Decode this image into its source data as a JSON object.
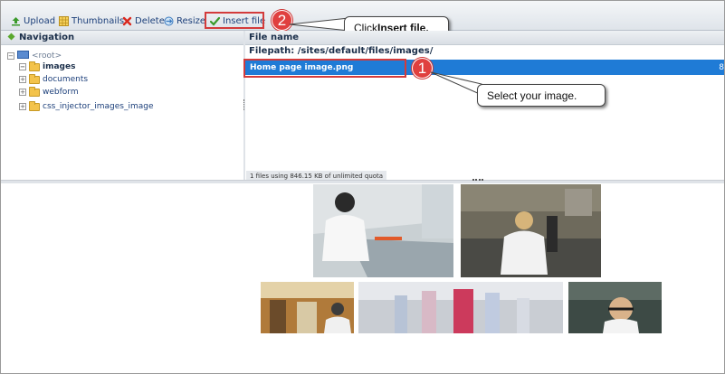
{
  "toolbar": {
    "upload": "Upload",
    "thumbnails": "Thumbnails",
    "delete": "Delete",
    "resize": "Resize",
    "insert_file": "Insert file"
  },
  "callouts": {
    "step2_number": "2",
    "step2_text_prefix": "Click ",
    "step2_text_bold": "Insert file.",
    "step1_number": "1",
    "step1_text": "Select your image."
  },
  "navigation": {
    "title": "Navigation",
    "root": "<root>",
    "folders": [
      "images",
      "documents",
      "webform",
      "css_injector_images_image"
    ]
  },
  "file_panel": {
    "column_header": "File name",
    "filepath": "Filepath: /sites/default/files/images/",
    "selected_file": "Home page image.png",
    "selected_file_size": "8",
    "quota": "1 files using 846.15 KB of unlimited quota"
  },
  "colors": {
    "accent_selected": "#1f7bd6",
    "annotation_red": "#d33b3b",
    "folder": "#f3c34b"
  }
}
